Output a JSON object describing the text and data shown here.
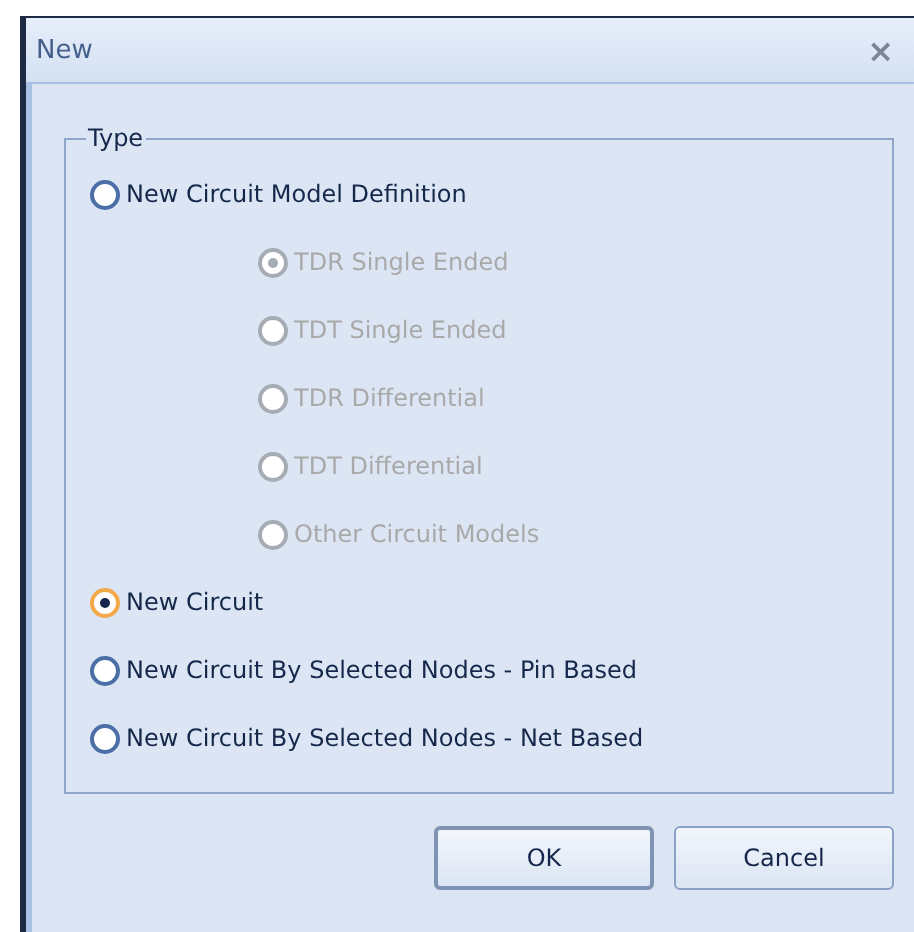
{
  "window": {
    "title": "New",
    "close": "×"
  },
  "group": {
    "title": "Type",
    "options": [
      {
        "label": "New Circuit Model Definition",
        "selected": false,
        "disabled": false,
        "children": [
          {
            "label": "TDR Single Ended",
            "selected": true,
            "disabled": true
          },
          {
            "label": "TDT Single Ended",
            "selected": false,
            "disabled": true
          },
          {
            "label": "TDR Differential",
            "selected": false,
            "disabled": true
          },
          {
            "label": "TDT Differential",
            "selected": false,
            "disabled": true
          },
          {
            "label": "Other Circuit Models",
            "selected": false,
            "disabled": true
          }
        ]
      },
      {
        "label": "New Circuit",
        "selected": true,
        "disabled": false
      },
      {
        "label": "New Circuit By Selected Nodes - Pin Based",
        "selected": false,
        "disabled": false
      },
      {
        "label": "New Circuit By Selected Nodes - Net Based",
        "selected": false,
        "disabled": false
      }
    ]
  },
  "buttons": [
    "OK",
    "Cancel"
  ]
}
